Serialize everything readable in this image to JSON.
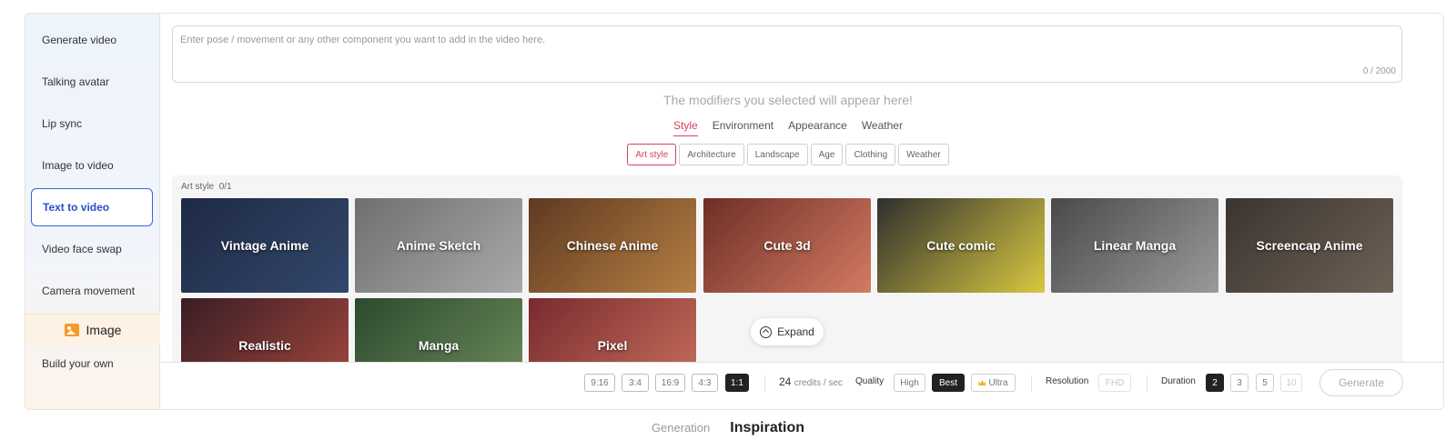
{
  "sidebar": {
    "items": [
      {
        "label": "Generate video",
        "active": false
      },
      {
        "label": "Talking avatar",
        "active": false
      },
      {
        "label": "Lip sync",
        "active": false
      },
      {
        "label": "Image to video",
        "active": false
      },
      {
        "label": "Text to video",
        "active": true
      },
      {
        "label": "Video face swap",
        "active": false
      },
      {
        "label": "Camera movement",
        "active": false
      }
    ],
    "section_title": "Image",
    "section_icon": "image-icon",
    "section_items": [
      {
        "label": "Build your own"
      }
    ]
  },
  "prompt": {
    "placeholder": "Enter pose / movement or any other component you want to add in the video here.",
    "value": "",
    "counter": "0 / 2000"
  },
  "modifiers_hint": "The modifiers you selected will appear here!",
  "modifier_tabs": [
    {
      "label": "Style",
      "active": true
    },
    {
      "label": "Environment",
      "active": false
    },
    {
      "label": "Appearance",
      "active": false
    },
    {
      "label": "Weather",
      "active": false
    }
  ],
  "chips": [
    {
      "label": "Art style",
      "active": true
    },
    {
      "label": "Architecture",
      "active": false
    },
    {
      "label": "Landscape",
      "active": false
    },
    {
      "label": "Age",
      "active": false
    },
    {
      "label": "Clothing",
      "active": false
    },
    {
      "label": "Weather",
      "active": false
    }
  ],
  "gallery": {
    "label": "Art style",
    "count": "0/1",
    "styles": [
      {
        "label": "Vintage Anime",
        "colors": [
          "#1e2a45",
          "#33476b"
        ]
      },
      {
        "label": "Anime Sketch",
        "colors": [
          "#6f6f6f",
          "#a9a9a9"
        ]
      },
      {
        "label": "Chinese Anime",
        "colors": [
          "#5f3a21",
          "#b57f43"
        ]
      },
      {
        "label": "Cute 3d",
        "colors": [
          "#6e2e26",
          "#d37b62"
        ]
      },
      {
        "label": "Cute comic",
        "colors": [
          "#2f2f2f",
          "#d8c840"
        ]
      },
      {
        "label": "Linear Manga",
        "colors": [
          "#4a4a4a",
          "#9a9a9a"
        ]
      },
      {
        "label": "Screencap Anime",
        "colors": [
          "#3b3430",
          "#6d6155"
        ]
      },
      {
        "label": "Realistic",
        "colors": [
          "#3a1d24",
          "#a3473e"
        ]
      },
      {
        "label": "Manga",
        "colors": [
          "#2e4a30",
          "#6b8a5a"
        ]
      },
      {
        "label": "Pixel",
        "colors": [
          "#7a2a30",
          "#c7705c"
        ]
      }
    ]
  },
  "expand_label": "Expand",
  "footer": {
    "ratios": [
      {
        "label": "9:16",
        "active": false
      },
      {
        "label": "3:4",
        "active": false
      },
      {
        "label": "16:9",
        "active": false
      },
      {
        "label": "4:3",
        "active": false
      },
      {
        "label": "1:1",
        "active": true
      }
    ],
    "credits_value": "24",
    "credits_unit": "credits / sec",
    "quality_label": "Quality",
    "quality_options": [
      {
        "label": "High",
        "active": false
      },
      {
        "label": "Best",
        "active": true
      },
      {
        "label": "Ultra",
        "active": false
      }
    ],
    "resolution_label": "Resolution",
    "resolution_value": "FHD",
    "duration_label": "Duration",
    "durations": [
      {
        "label": "2",
        "active": true
      },
      {
        "label": "3",
        "active": false
      },
      {
        "label": "5",
        "active": false
      },
      {
        "label": "10",
        "active": false,
        "disabled": true
      }
    ],
    "generate_label": "Generate"
  },
  "bottom_tabs": [
    {
      "label": "Generation",
      "active": false
    },
    {
      "label": "Inspiration",
      "active": true
    }
  ]
}
